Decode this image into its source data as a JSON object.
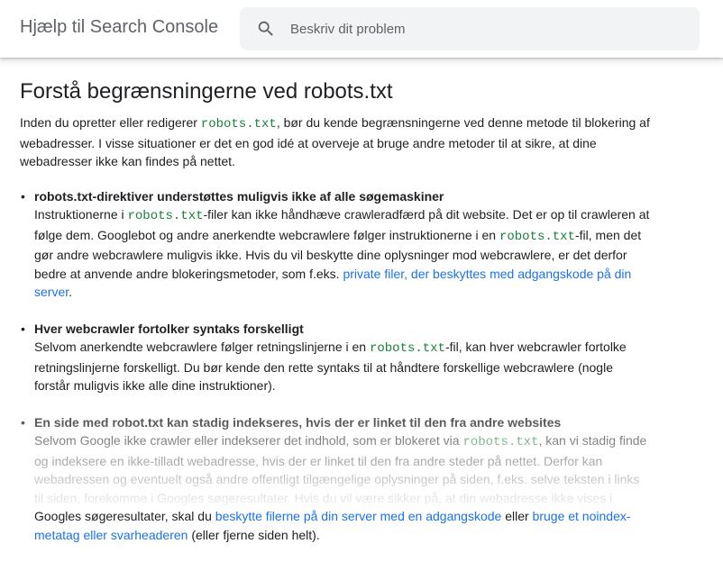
{
  "header": {
    "brand": "Hjælp til Search Console",
    "search_placeholder": "Beskriv dit problem",
    "search_value": "",
    "search_icon": "search-icon"
  },
  "article": {
    "title": "Forstå begrænsningerne ved robots.txt",
    "intro": {
      "before": "Inden du opretter eller redigerer ",
      "code": "robots.txt",
      "after": ", bør du kende begrænsningerne ved denne metode til blokering af webadresser. I visse situationer er det en god idé at overveje at bruge andre metoder til at sikre, at dine webadresser ikke kan findes på nettet."
    },
    "bullet_symbol": "•",
    "items": [
      {
        "title": "robots.txt-direktiver understøttes muligvis ikke af alle søgemaskiner",
        "p1": "Instruktionerne i ",
        "c1": "robots.txt",
        "p2": "-filer kan ikke håndhæve crawleradfærd på dit website. Det er op til crawleren at følge dem. Googlebot og andre anerkendte webcrawlere følger instruktionerne i en ",
        "c2": "robots.txt",
        "p3": "-fil, men det gør andre webcrawlere muligvis ikke. Hvis du vil beskytte dine oplysninger mod webcrawlere, er det derfor bedre at anvende andre blokeringsmetoder, som f.eks. ",
        "link": "private filer, der beskyttes med adgangskode på din server",
        "p4": "."
      },
      {
        "title": "Hver webcrawler fortolker syntaks forskelligt",
        "p1": "Selvom anerkendte webcrawlere følger retningslinjerne i en ",
        "c1": "robots.txt",
        "p2": "-fil, kan hver webcrawler fortolke retningslinjerne forskelligt. Du bør kende den rette syntaks til at håndtere forskellige webcrawlere (nogle forstår muligvis ikke alle dine instruktioner)."
      },
      {
        "title": "En side med robot.txt kan stadig indekseres, hvis der er linket til den fra andre websites",
        "p1": "Selvom Google ikke crawler eller indekserer det indhold, som er blokeret via ",
        "c1": "robots.txt",
        "p2": ", kan vi stadig finde og indeksere en ikke-tilladt webadresse, hvis der er linket til den fra andre steder på nettet. Derfor kan webadressen og eventuelt også andre offentligt tilgængelige oplysninger på siden, f.eks. selve teksten i links til siden, forekomme i Googles søgeresultater. Hvis du vil være sikker på, at din webadresse ikke vises i Googles søgeresultater, skal du ",
        "link1": "beskytte filerne på din server med en adgangskode",
        "p3": " eller ",
        "link2": "bruge et noindex-metatag eller svarheaderen",
        "p4": " (eller fjerne siden helt)."
      }
    ]
  },
  "colors": {
    "text": "#202124",
    "brand": "#5f6368",
    "link": "#1a73e8",
    "code": "#188038",
    "search_bg": "#f1f3f4"
  }
}
